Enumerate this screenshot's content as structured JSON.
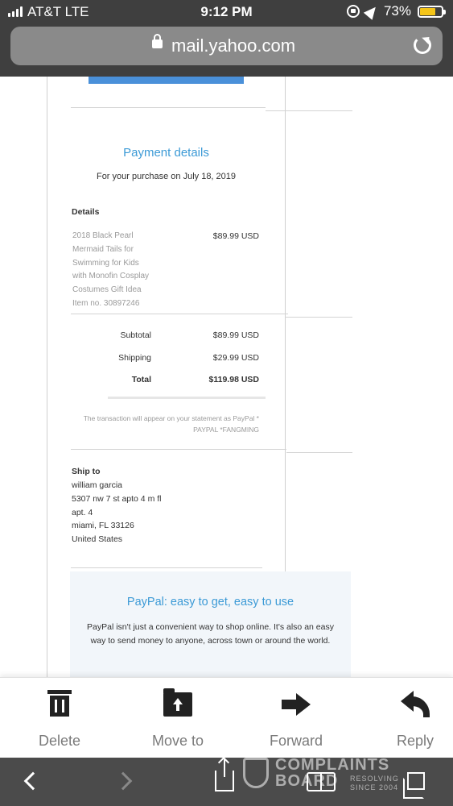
{
  "status_bar": {
    "carrier": "AT&T  LTE",
    "time": "9:12 PM",
    "battery_percent": "73%",
    "battery_level": 0.73,
    "icons": [
      "signal-icon",
      "rotation-lock-icon",
      "location-icon",
      "battery-icon"
    ]
  },
  "browser": {
    "url": "mail.yahoo.com",
    "icons": [
      "lock-icon",
      "reload-icon"
    ]
  },
  "email": {
    "payment_title": "Payment details",
    "purchase_line": "For your purchase on July 18, 2019",
    "details_heading": "Details",
    "item_lines": [
      "2018 Black Pearl",
      "Mermaid Tails for",
      "Swimming for Kids",
      "with Monofin Cosplay",
      "Costumes Gift Idea",
      "Item no. 30897246"
    ],
    "item_price": "$89.99 USD",
    "summary": [
      {
        "label": "Subtotal",
        "value": "$89.99 USD"
      },
      {
        "label": "Shipping",
        "value": "$29.99 USD"
      },
      {
        "label": "Total",
        "value": "$119.98 USD"
      }
    ],
    "transaction_note": "The transaction will appear on your statement as PayPal * PAYPAL *FANGMING",
    "ship_to_heading": "Ship to",
    "ship_to_lines": [
      "william garcia",
      "5307 nw 7 st apto 4 m fl",
      "apt. 4",
      "miami, FL 33126",
      "United States"
    ],
    "promo_title": "PayPal: easy to get, easy to use",
    "promo_text": "PayPal isn't just a convenient way to shop online. It's also an easy way to send money to anyone, across town or around the world."
  },
  "mail_toolbar": {
    "delete": "Delete",
    "move_to": "Move to",
    "forward": "Forward",
    "reply": "Reply"
  },
  "watermark": {
    "line1": "COMPLAINTS",
    "line2": "BOARD",
    "tag1": "RESOLVING",
    "tag2": "SINCE 2004"
  }
}
